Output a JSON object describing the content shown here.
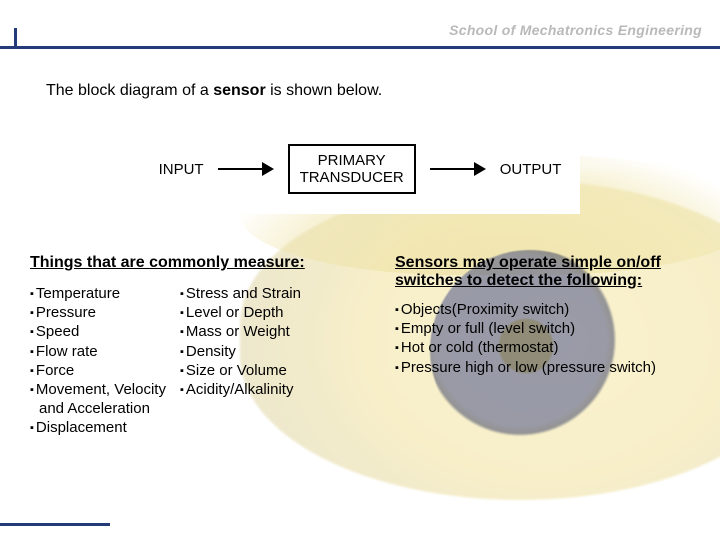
{
  "header": {
    "school": "School of Mechatronics Engineering"
  },
  "intro": {
    "before": "The block diagram of a ",
    "bold": "sensor",
    "after": " is shown below."
  },
  "diagram": {
    "input": "INPUT",
    "box_line1": "PRIMARY",
    "box_line2": "TRANSDUCER",
    "output": "OUTPUT"
  },
  "left": {
    "heading": "Things that are commonly measure:",
    "col1": [
      "Temperature",
      "Pressure",
      "Speed",
      "Flow rate",
      "Force",
      "Movement, Velocity and Acceleration",
      "Displacement"
    ],
    "col2": [
      "Stress and Strain",
      "Level or Depth",
      "Mass or Weight",
      "Density",
      "Size or Volume",
      "Acidity/Alkalinity"
    ]
  },
  "right": {
    "heading": "Sensors may operate simple on/off switches to detect the following:",
    "items": [
      "Objects(Proximity switch)",
      "Empty or full (level switch)",
      "Hot or cold (thermostat)",
      "Pressure high or low (pressure switch)"
    ]
  }
}
